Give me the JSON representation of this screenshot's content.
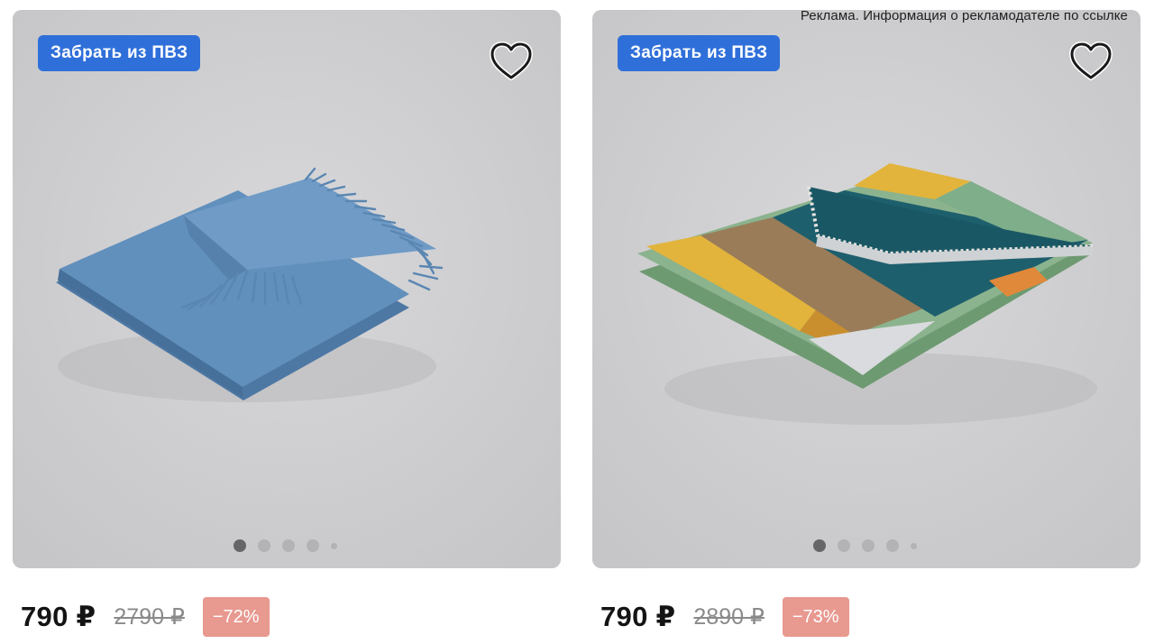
{
  "ad_notice": "Реклама. Информация о рекламодателе по ссылке",
  "products": [
    {
      "badge": "Забрать из ПВЗ",
      "favorite_icon": "heart-outline-icon",
      "image": "blue fringed throw blanket",
      "gallery_dots": {
        "count": 5,
        "active_index": 0
      },
      "price": "790 ₽",
      "old_price": "2790 ₽",
      "discount": "−72%",
      "colors": {
        "blanket": "#5b87b3"
      }
    },
    {
      "badge": "Забрать из ПВЗ",
      "favorite_icon": "heart-outline-icon",
      "image": "multicolor folded blanket",
      "gallery_dots": {
        "count": 5,
        "active_index": 0
      },
      "price": "790 ₽",
      "old_price": "2890 ₽",
      "discount": "−73%",
      "colors": {
        "teal": "#1e5f6d",
        "yellow": "#e2b43c",
        "green": "#7fae8a"
      }
    }
  ],
  "colors": {
    "badge_blue": "#2f6fd9",
    "discount_bg": "#e89990",
    "card_bg": "#cdcdcf"
  }
}
